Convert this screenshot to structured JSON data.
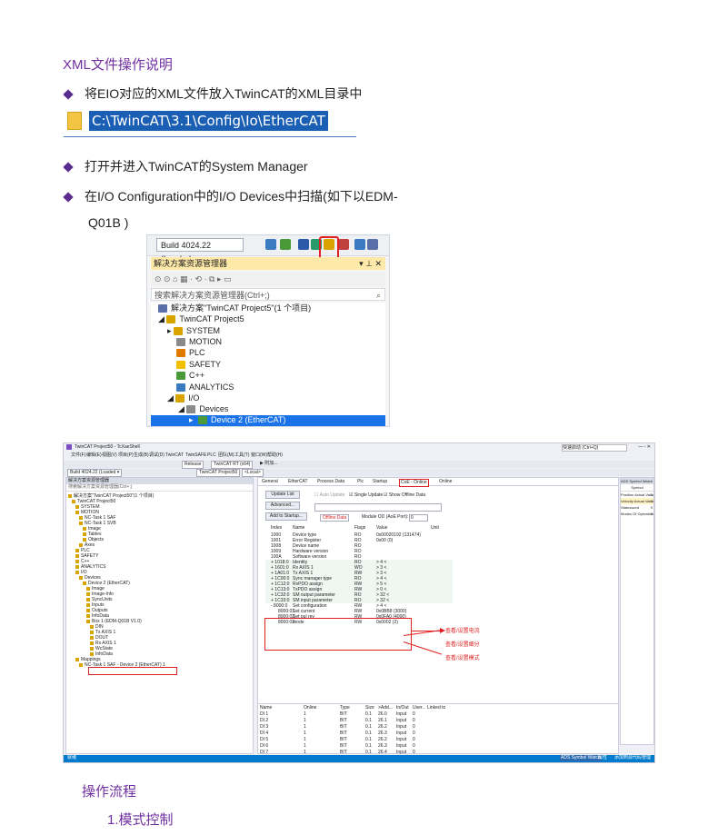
{
  "doc": {
    "title": "XML文件操作说明",
    "bullets": [
      "将EIO对应的XML文件放入TwinCAT的XML目录中",
      "打开并进入TwinCAT的System Manager",
      "在I/O  Configuration中的I/O  Devices中扫描(如下以EDM-",
      "Q01B )"
    ],
    "path": "C:\\TwinCAT\\3.1\\Config\\Io\\EtherCAT",
    "section": "操作流程",
    "subsection": "1.模式控制"
  },
  "shot1": {
    "build_select": "Build 4024.22 (Loaded",
    "panel_title": "解决方案资源管理器",
    "panel_controls": "▾ ⊥ ✕",
    "search_placeholder": "搜索解决方案资源管理器(Ctrl+;)",
    "tree": [
      {
        "label": "解决方案\"TwinCAT Project5\"(1 个项目)",
        "color": "#5a6fa8"
      },
      {
        "label": "TwinCAT Project5",
        "color": "#d9a300"
      },
      {
        "label": "SYSTEM",
        "color": "#d9a300"
      },
      {
        "label": "MOTION",
        "color": "#8a8a8a"
      },
      {
        "label": "PLC",
        "color": "#e07b00"
      },
      {
        "label": "SAFETY",
        "color": "#f0c000"
      },
      {
        "label": "C++",
        "color": "#4a9a3a"
      },
      {
        "label": "ANALYTICS",
        "color": "#3a7ac0"
      },
      {
        "label": "I/O",
        "color": "#d9a300"
      },
      {
        "label": "Devices",
        "color": "#8a8a8a"
      },
      {
        "label": "Device 2 (EtherCAT)",
        "color": "#4a9a3a"
      }
    ]
  },
  "shot2": {
    "window_title": "TwinCAT Project50 - TcXaeShell",
    "quick_launch": "快速启动 (Ctrl+Q)",
    "menu": [
      "文件(F)",
      "编辑(E)",
      "视图(V)",
      "项目(P)",
      "生成(B)",
      "调试(D)",
      "TwinCAT",
      "TwinSAFE",
      "PLC",
      "团队(M)",
      "工具(T)",
      "窗口(W)",
      "帮助(H)"
    ],
    "toolbar1": [
      "Release",
      "TwinCAT RT (x64)",
      "▶ 附加..."
    ],
    "toolbar2": [
      "Build 4024.22 (Loaded ▾",
      "TwinCAT Project50",
      "<Local>"
    ],
    "left_title": "解决方案资源管理器",
    "left_search": "搜索解决方案资源管理器(Ctrl+;)",
    "tree": [
      "解决方案\"TwinCAT Project50\"(1 个项目)",
      "TwinCAT Project50",
      "SYSTEM",
      "MOTION",
      "NC-Task 1 SAF",
      "NC-Task 1 SVB",
      "Image",
      "Tables",
      "Objects",
      "Axes",
      "PLC",
      "SAFETY",
      "C++",
      "ANALYTICS",
      "I/O",
      "Devices",
      "Device 2 (EtherCAT)",
      "Image",
      "Image-Info",
      "SyncUnits",
      "Inputs",
      "Outputs",
      "InfoData",
      "Box 1 (EDM-Q01B V1.0)",
      "DIN",
      "Tx AXIS 1",
      "DOUT",
      "Rx AXIS 1",
      "WcState",
      "InfoData",
      "Mappings",
      "NC-Task 1 SAF - Device 2 (EtherCAT) 1"
    ],
    "tabs": [
      "General",
      "EtherCAT",
      "Process Data",
      "Plc",
      "Startup",
      "CoE - Online",
      "Online"
    ],
    "buttons": [
      "Update List",
      "Advanced...",
      "Add to Startup..."
    ],
    "checkboxes": [
      "Auto Update",
      "Single Update",
      "Show Offline Data"
    ],
    "offline_data": "Offline Data",
    "module_od_label": "Module OD (AoE Port):",
    "module_od_value": "0",
    "columns": [
      "Index",
      "Name",
      "Flags",
      "Value",
      "Unit"
    ],
    "rows": [
      [
        "1000",
        "Device type",
        "RO",
        "0x00020192 (131474)"
      ],
      [
        "1001",
        "Error Register",
        "RO",
        "0x00 (0)"
      ],
      [
        "1008",
        "Device name",
        "RO",
        ""
      ],
      [
        "1009",
        "Hardware version",
        "RO",
        ""
      ],
      [
        "100A",
        "Software version",
        "RO",
        ""
      ],
      [
        "+ 1018:0",
        "Identity",
        "RO",
        "> 4 <"
      ],
      [
        "+ 1601:0",
        "Rx AXIS 1",
        "WO",
        "> 3 <"
      ],
      [
        "+ 1A01:0",
        "Tx AXIS 1",
        "RW",
        "> 3 <"
      ],
      [
        "+ 1C00:0",
        "Sync manager type",
        "RO",
        "> 4 <"
      ],
      [
        "+ 1C12:0",
        "RxPDO assign",
        "RW",
        "> 5 <"
      ],
      [
        "+ 1C13:0",
        "TxPDO assign",
        "RW",
        "> 0 <"
      ],
      [
        "+ 1C32:0",
        "SM output parameter",
        "RO",
        "> 32 <"
      ],
      [
        "+ 1C33:0",
        "SM input parameter",
        "RO",
        "> 32 <"
      ],
      [
        "- 8000:0",
        "Set configuration",
        "RW",
        "> 4 <"
      ],
      [
        "8000:01",
        "Set current",
        "RW",
        "0x0BB8 (3000)"
      ],
      [
        "8000:02",
        "Set pul rev",
        "RW",
        "0x0FA0 (4000)"
      ],
      [
        "8000:03",
        "mode",
        "RW",
        "0x0002 (2)"
      ]
    ],
    "annotations": [
      "查看/设置电流",
      "查看/设置细分",
      "查看/设置模式"
    ],
    "bottom_columns": [
      "Name",
      "Online",
      "Type",
      "Size",
      ">Add...",
      "In/Out",
      "User..",
      "Linked to"
    ],
    "bottom_rows": [
      [
        "DI 1",
        "1",
        "BIT",
        "0.1",
        "26.0",
        "Input",
        "0"
      ],
      [
        "DI 2",
        "1",
        "BIT",
        "0.1",
        "26.1",
        "Input",
        "0"
      ],
      [
        "DI 3",
        "1",
        "BIT",
        "0.1",
        "26.2",
        "Input",
        "0"
      ],
      [
        "DI 4",
        "1",
        "BIT",
        "0.1",
        "26.3",
        "Input",
        "0"
      ],
      [
        "DI 5",
        "1",
        "BIT",
        "0.1",
        "26.2",
        "Input",
        "0"
      ],
      [
        "DI 6",
        "1",
        "BIT",
        "0.1",
        "26.3",
        "Input",
        "0"
      ],
      [
        "DI 7",
        "1",
        "BIT",
        "0.1",
        "26.4",
        "Input",
        "0"
      ]
    ],
    "right_title": "ADS Symbol Watch",
    "right_header": "Symbol",
    "right_rows": [
      [
        "Position Actual Value",
        "0"
      ],
      [
        "Velocity Actual Value",
        "0"
      ],
      [
        "Statusword",
        "0"
      ],
      [
        "Modes Of Operation Display",
        "0"
      ]
    ],
    "status_left": "就绪",
    "status_right": "添加到源代码管理",
    "bottom_tabs": [
      "ADS Symbol Watch",
      "属性"
    ]
  }
}
